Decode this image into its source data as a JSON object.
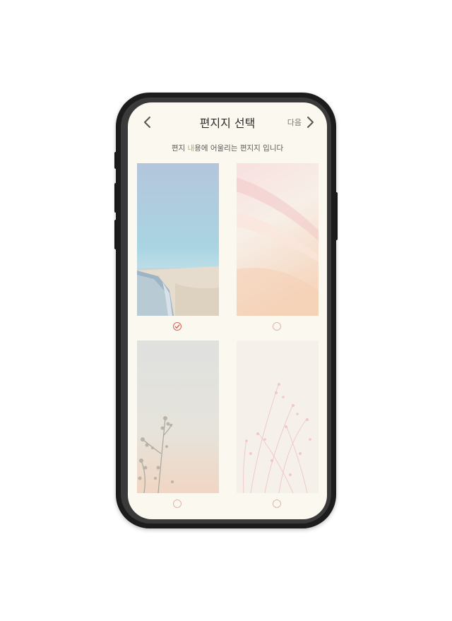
{
  "header": {
    "title": "편지지 선택",
    "next_label": "다음"
  },
  "subtitle": {
    "before": "편지 ",
    "highlight": "내",
    "after": "용에 어울리는 편지지 입니다"
  },
  "icons": {
    "back": "chevron-left-icon",
    "next": "chevron-right-icon",
    "selected": "check-circle-icon"
  },
  "stationery": [
    {
      "name": "beach",
      "selected": true
    },
    {
      "name": "pink-silk",
      "selected": false
    },
    {
      "name": "blossom-branch",
      "selected": false
    },
    {
      "name": "pink-grass",
      "selected": false
    }
  ],
  "colors": {
    "screen_bg": "#fbf9ef",
    "accent": "#d9625a",
    "highlight": "#c9a25a"
  }
}
